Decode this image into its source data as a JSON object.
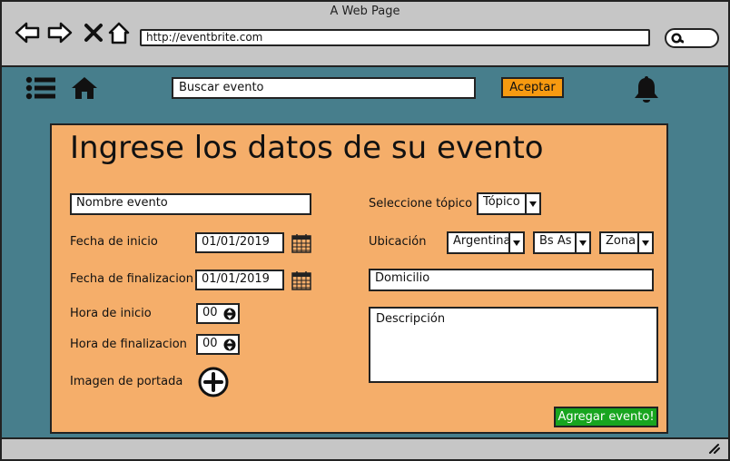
{
  "window": {
    "title": "A Web Page",
    "url": "http://eventbrite.com"
  },
  "toolbar": {
    "search_placeholder": "Buscar evento",
    "accept_label": "Aceptar"
  },
  "form": {
    "heading": "Ingrese los datos de su evento",
    "event_name_placeholder": "Nombre evento",
    "start_date_label": "Fecha de inicio",
    "start_date_value": "01/01/2019",
    "end_date_label": "Fecha de finalizacion",
    "end_date_value": "01/01/2019",
    "start_time_label": "Hora de inicio",
    "start_time_value": "00",
    "end_time_label": "Hora de finalizacion",
    "end_time_value": "00",
    "cover_image_label": "Imagen de portada",
    "topic_label": "Seleccione tópico",
    "topic_value": "Tópico",
    "location_label": "Ubicación",
    "country_value": "Argentina",
    "province_value": "Bs As",
    "zone_value": "Zona",
    "address_placeholder": "Domicilio",
    "description_placeholder": "Descripción",
    "submit_label": "Agregar evento!"
  },
  "colors": {
    "accent": "#f79a10",
    "panel": "#f5ae6a",
    "header": "#477e8c",
    "submit": "#18a51f"
  }
}
